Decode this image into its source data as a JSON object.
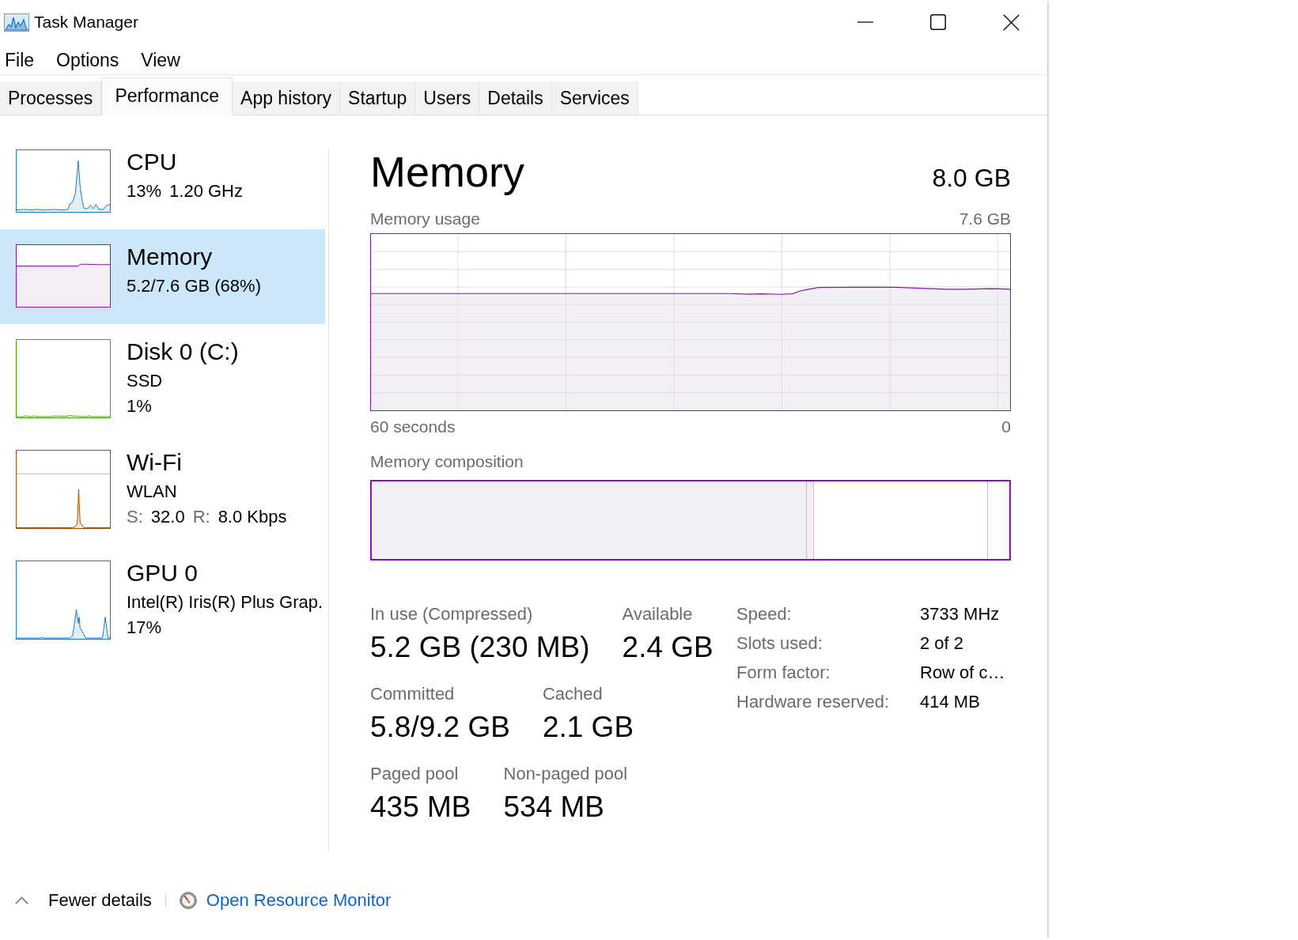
{
  "window": {
    "title": "Task Manager"
  },
  "menu": [
    "File",
    "Options",
    "View"
  ],
  "tabs": [
    {
      "label": "Processes",
      "selected": false
    },
    {
      "label": "Performance",
      "selected": true
    },
    {
      "label": "App history",
      "selected": false
    },
    {
      "label": "Startup",
      "selected": false
    },
    {
      "label": "Users",
      "selected": false
    },
    {
      "label": "Details",
      "selected": false
    },
    {
      "label": "Services",
      "selected": false
    }
  ],
  "sidebar": {
    "items": [
      {
        "kind": "cpu",
        "title": "CPU",
        "color": "#1a7bc4",
        "selected": false,
        "lines": [
          [
            {
              "kind": "value",
              "text": "13%"
            },
            {
              "kind": "value",
              "text": "1.20 GHz"
            }
          ]
        ]
      },
      {
        "kind": "memory",
        "title": "Memory",
        "color": "#8b12ae",
        "selected": true,
        "lines": [
          [
            {
              "kind": "value",
              "text": "5.2/7.6 GB (68%)"
            }
          ]
        ]
      },
      {
        "kind": "disk",
        "title": "Disk 0 (C:)",
        "color": "#4da60c",
        "selected": false,
        "lines": [
          [
            {
              "kind": "value",
              "text": "SSD"
            }
          ],
          [
            {
              "kind": "value",
              "text": "1%"
            }
          ]
        ]
      },
      {
        "kind": "network",
        "title": "Wi-Fi",
        "color": "#a74f01",
        "selected": false,
        "lines": [
          [
            {
              "kind": "value",
              "text": "WLAN"
            }
          ],
          [
            {
              "kind": "label",
              "text": "S:"
            },
            {
              "kind": "value",
              "text": "32.0"
            },
            {
              "kind": "label",
              "text": "R:"
            },
            {
              "kind": "value",
              "text": "8.0 Kbps"
            }
          ]
        ]
      },
      {
        "kind": "gpu",
        "title": "GPU 0",
        "color": "#1a7bc4",
        "selected": false,
        "lines": [
          [
            {
              "kind": "value",
              "text": "Intel(R) Iris(R) Plus Grap."
            }
          ],
          [
            {
              "kind": "value",
              "text": "17%"
            }
          ]
        ]
      }
    ]
  },
  "detail": {
    "title": "Memory",
    "capacity": "8.0 GB",
    "usage_graph": {
      "label": "Memory usage",
      "max": "7.6 GB",
      "start": "60 seconds",
      "end": "0"
    },
    "composition": {
      "label": "Memory composition",
      "layers": [
        {
          "kind": "in_use",
          "level": 0.683
        },
        {
          "kind": "modified",
          "level": 0.693
        },
        {
          "kind": "standby",
          "level": 0.966
        }
      ]
    },
    "stat_rows": [
      [
        {
          "label": "In use (Compressed)",
          "value": "5.2 GB (230 MB)"
        },
        {
          "label": "Available",
          "value": "2.4 GB"
        }
      ],
      [
        {
          "label": "Committed",
          "value": "5.8/9.2 GB"
        },
        {
          "label": "Cached",
          "value": "2.1 GB"
        }
      ],
      [
        {
          "label": "Paged pool",
          "value": "435 MB"
        },
        {
          "label": "Non-paged pool",
          "value": "534 MB"
        }
      ]
    ],
    "properties": [
      {
        "label": "Speed:",
        "value": "3733 MHz"
      },
      {
        "label": "Slots used:",
        "value": "2 of 2"
      },
      {
        "label": "Form factor:",
        "value": "Row of c…"
      },
      {
        "label": "Hardware reserved:",
        "value": "414 MB"
      }
    ]
  },
  "footer": {
    "toggle": "Fewer details",
    "link": "Open Resource Monitor"
  }
}
